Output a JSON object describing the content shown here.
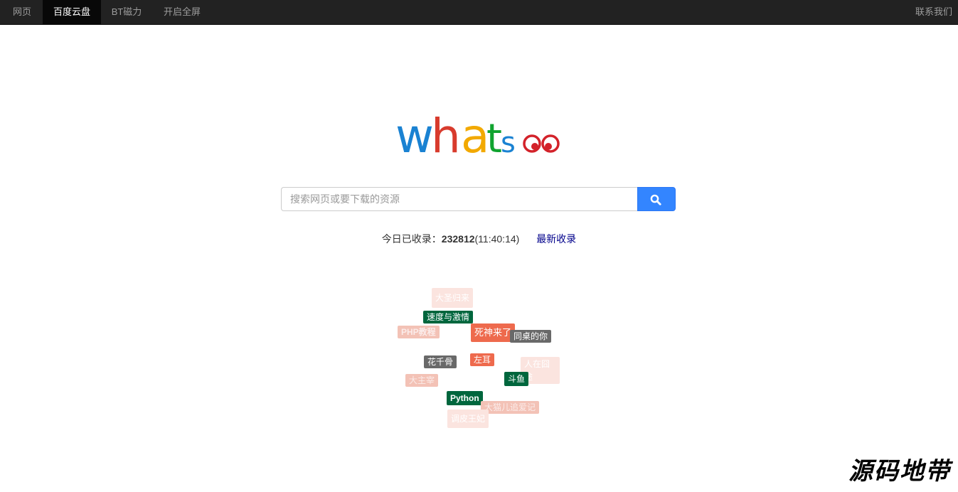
{
  "nav": {
    "items": [
      {
        "label": "网页",
        "active": false
      },
      {
        "label": "百度云盘",
        "active": true
      },
      {
        "label": "BT磁力",
        "active": false
      },
      {
        "label": "开启全屏",
        "active": false
      }
    ],
    "contact": "联系我们"
  },
  "logo": {
    "letters": [
      "w",
      "h",
      "a",
      "t",
      "s"
    ],
    "colors": [
      "#1a82d2",
      "#d83b2d",
      "#f2a900",
      "#10a32f",
      "#1a82d2"
    ],
    "eye_color": "#d3222a"
  },
  "search": {
    "placeholder": "搜索网页或要下载的资源",
    "value": "",
    "button_icon": "search-icon",
    "button_color": "#3385ff"
  },
  "stats": {
    "prefix": "今日已收录：",
    "count": "232812",
    "time": "(11:40:14)",
    "latest_link": "最新收录"
  },
  "tags": [
    {
      "label": "大圣归来",
      "style": "pale"
    },
    {
      "label": "速度与激情",
      "style": "green"
    },
    {
      "label": "PHP教程",
      "style": "pink"
    },
    {
      "label": "死神来了",
      "style": "orange"
    },
    {
      "label": "同桌的你",
      "style": "gray"
    },
    {
      "label": "花千骨",
      "style": "gray"
    },
    {
      "label": "左耳",
      "style": "orange"
    },
    {
      "label": "人在囧途",
      "style": "pale"
    },
    {
      "label": "大主宰",
      "style": "pink"
    },
    {
      "label": "斗鱼",
      "style": "green"
    },
    {
      "label": "Python",
      "style": "green"
    },
    {
      "label": "大猫儿追爱记",
      "style": "pink"
    },
    {
      "label": "调皮王妃",
      "style": "pale"
    }
  ],
  "watermark": "源码地带"
}
